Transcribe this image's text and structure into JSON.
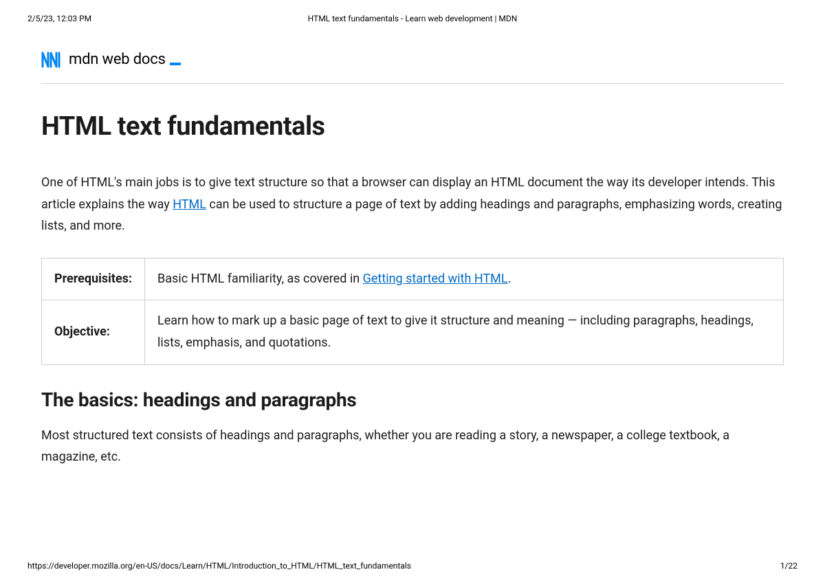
{
  "print": {
    "timestamp": "2/5/23, 12:03 PM",
    "title": "HTML text fundamentals - Learn web development | MDN",
    "url": "https://developer.mozilla.org/en-US/docs/Learn/HTML/Introduction_to_HTML/HTML_text_fundamentals",
    "page": "1/22"
  },
  "logo": {
    "text": "mdn web docs"
  },
  "page_title": "HTML text fundamentals",
  "intro": {
    "part1": "One of HTML's main jobs is to give text structure so that a browser can display an HTML document the way its developer intends. This article explains the way ",
    "link1": "HTML",
    "part2": " can be used to structure a page of text by adding headings and paragraphs, emphasizing words, creating lists, and more."
  },
  "table": {
    "row1": {
      "header": "Prerequisites:",
      "text1": "Basic HTML familiarity, as covered in ",
      "link": "Getting started with HTML",
      "text2": "."
    },
    "row2": {
      "header": "Objective:",
      "text": "Learn how to mark up a basic page of text to give it structure and meaning — including paragraphs, headings, lists, emphasis, and quotations."
    }
  },
  "section1": {
    "heading": "The basics: headings and paragraphs",
    "body": "Most structured text consists of headings and paragraphs, whether you are reading a story, a newspaper, a college textbook, a magazine, etc."
  }
}
